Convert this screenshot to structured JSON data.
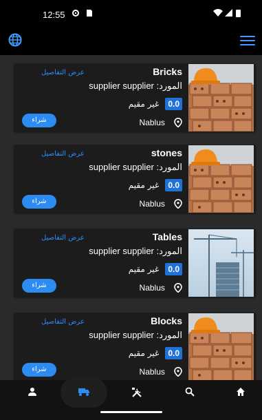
{
  "status_bar": {
    "time": "12:55"
  },
  "products": [
    {
      "title": "Bricks",
      "details_label": "عرض التفاصيل",
      "supplier": "المورد: supplier supplier",
      "rating": "0.0",
      "rating_label": "غير مقيم",
      "location": "Nablus",
      "buy_label": "شراء",
      "image": "bricks-photo"
    },
    {
      "title": "stones",
      "details_label": "عرض التفاصيل",
      "supplier": "المورد: supplier supplier",
      "rating": "0.0",
      "rating_label": "غير مقيم",
      "location": "Nablus",
      "buy_label": "شراء",
      "image": "bricks-photo"
    },
    {
      "title": "Tables",
      "details_label": "عرض التفاصيل",
      "supplier": "المورد: supplier supplier",
      "rating": "0.0",
      "rating_label": "غير مقيم",
      "location": "Nablus",
      "buy_label": "شراء",
      "image": "crane-building-photo"
    },
    {
      "title": "Blocks",
      "details_label": "عرض التفاصيل",
      "supplier": "المورد: supplier supplier",
      "rating": "0.0",
      "rating_label": "غير مقيم",
      "location": "Nablus",
      "buy_label": "شراء",
      "image": "bricks-photo"
    }
  ],
  "bottom_nav": [
    "profile-icon",
    "truck-icon",
    "tools-icon",
    "search-icon",
    "home-icon"
  ],
  "colors": {
    "accent": "#2c8cf2",
    "card": "#1c1c1c",
    "background": "#2a2a2a"
  }
}
